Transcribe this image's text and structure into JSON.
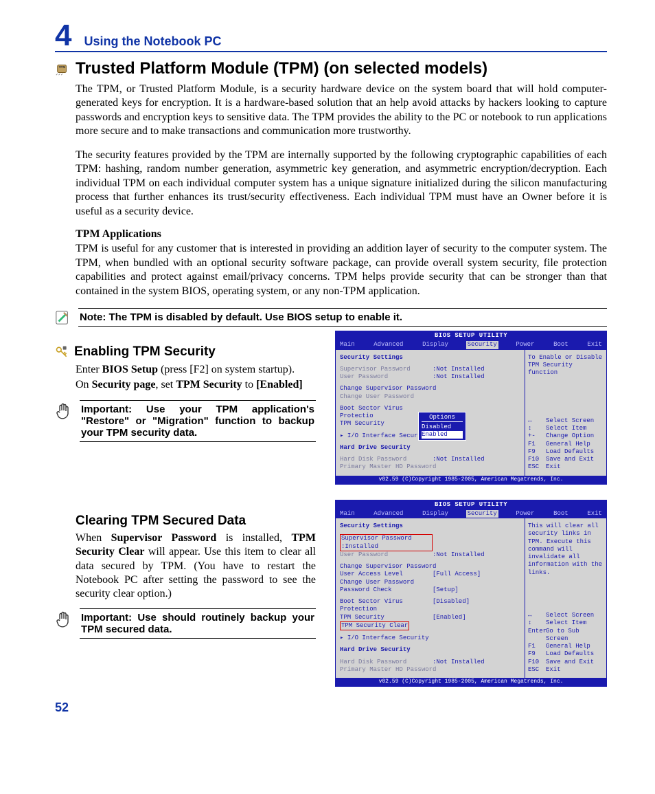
{
  "chapter": {
    "number": "4",
    "title": "Using the Notebook PC"
  },
  "h1": "Trusted Platform Module (TPM) (on selected models)",
  "para1": "The TPM, or Trusted Platform Module, is a security hardware device on the system board that will hold computer-generated keys for encryption. It is a hardware-based solution that an help avoid attacks by hackers looking to capture passwords and encryption keys to sensitive data. The TPM provides the ability to the PC or notebook to run applications more secure and to make transactions and communication more trustworthy.",
  "para2": "The security features provided by the TPM are internally supported by the following cryptographic capabilities of each TPM: hashing, random number generation, asymmetric key generation, and asymmetric encryption/decryption. Each individual TPM on each individual computer system has a unique signature initialized during the silicon manufacturing process that further enhances its trust/security effectiveness. Each individual TPM must have an Owner before it is useful as a security device.",
  "subhead1": "TPM Applications",
  "para3": "TPM is useful for any customer that is interested in providing an addition layer of security to the computer system. The TPM, when bundled with an optional security software package, can provide overall system security, file protection capabilities and protect against email/privacy concerns. TPM helps provide security that can be stronger than that contained in the system BIOS, operating system, or any non-TPM application.",
  "note1": "Note: The TPM is disabled by default. Use BIOS setup to enable it.",
  "h2a": "Enabling TPM Security",
  "steps_a1_pre": "Enter ",
  "steps_a1_b": "BIOS Setup",
  "steps_a1_post": " (press [F2] on system startup).",
  "steps_a2_pre": "On ",
  "steps_a2_b1": "Security page",
  "steps_a2_mid": ", set ",
  "steps_a2_b2": "TPM Security",
  "steps_a2_mid2": " to ",
  "steps_a2_b3": "[Enabled]",
  "important_a": "Important: Use your TPM application's \"Restore\" or \"Migration\" function to backup your TPM security data.",
  "h2b": "Clearing TPM Secured Data",
  "clr_pre": "When ",
  "clr_b1": "Supervisor Password",
  "clr_mid1": " is installed, ",
  "clr_b2": "TPM Security Clear",
  "clr_post": " will appear. Use this item to clear all data secured by TPM. (You have to restart the Notebook PC after setting the password to see the security clear option.)",
  "important_b": "Important: Use should routinely backup your TPM secured data.",
  "page_num": "52",
  "bios": {
    "title": "BIOS SETUP UTILITY",
    "menu": [
      "Main",
      "Advanced",
      "Display",
      "Security",
      "Power",
      "Boot",
      "Exit"
    ],
    "foot": "v02.59 (C)Copyright 1985-2005, American Megatrends, Inc.",
    "sec_hdr": "Security Settings",
    "rows1": {
      "sup": "Supervisor Password",
      "sup_v": ":Not Installed",
      "usr": "User Password",
      "usr_v": ":Not Installed",
      "chg_sup": "Change Supervisor Password",
      "chg_usr": "Change User Password",
      "bsv": "Boot Sector Virus Protectio",
      "tpm": "TPM Security",
      "iface": "▸ I/O Interface Security",
      "hd_hdr": "Hard Drive Security",
      "hd_pwd": "Hard Disk Password",
      "hd_pwd_v": ":Not Installed",
      "pm_pwd": "Primary Master HD Password"
    },
    "rows2": {
      "sup": "Supervisor Password",
      "sup_v": ":Installed",
      "usr": "User Password",
      "usr_v": ":Not Installed",
      "chg_sup": "Change Supervisor Password",
      "ual": "User Access Level",
      "ual_v": "[Full Access]",
      "chg_usr": "Change User Password",
      "pwchk": "Password Check",
      "pwchk_v": "[Setup]",
      "bsv": "Boot Sector Virus Protection",
      "bsv_v": "[Disabled]",
      "tpm": "TPM Security",
      "tpm_v": "[Enabled]",
      "tclr": "TPM Security Clear",
      "iface": "▸ I/O Interface Security",
      "hd_hdr": "Hard Drive Security",
      "hd_pwd": "Hard Disk Password",
      "hd_pwd_v": ":Not Installed",
      "pm_pwd": "Primary Master HD Password"
    },
    "help1": "To Enable or Disable TPM Security function",
    "help2": "This will clear all security links in TPM. Execute this command will invalidate all information with the links.",
    "popup": {
      "title": "Options",
      "opt1": "Disabled",
      "opt2": "Enabled"
    },
    "keys1": [
      [
        "↔",
        "Select Screen"
      ],
      [
        "↕",
        "Select Item"
      ],
      [
        "+-",
        "Change Option"
      ],
      [
        "F1",
        "General Help"
      ],
      [
        "F9",
        "Load Defaults"
      ],
      [
        "F10",
        "Save and Exit"
      ],
      [
        "ESC",
        "Exit"
      ]
    ],
    "keys2": [
      [
        "↔",
        "Select Screen"
      ],
      [
        "↕",
        "Select Item"
      ],
      [
        "Enter",
        "Go to Sub Screen"
      ],
      [
        "F1",
        "General Help"
      ],
      [
        "F9",
        "Load Defaults"
      ],
      [
        "F10",
        "Save and Exit"
      ],
      [
        "ESC",
        "Exit"
      ]
    ]
  }
}
